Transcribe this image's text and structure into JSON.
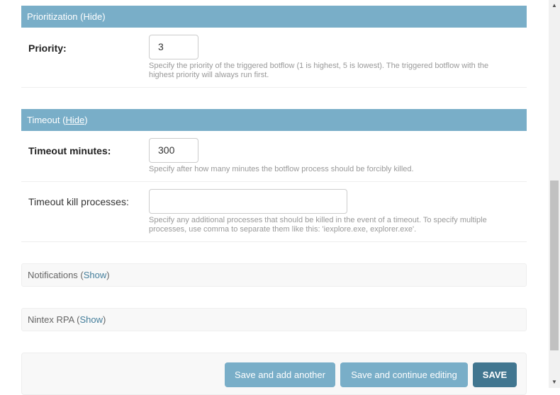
{
  "prioritization": {
    "title": "Prioritization",
    "toggle_prefix": " (",
    "toggle": "Hide",
    "toggle_suffix": ")",
    "priority": {
      "label": "Priority:",
      "value": "3",
      "help": "Specify the priority of the triggered botflow (1 is highest, 5 is lowest). The triggered botflow with the highest priority will always run first."
    }
  },
  "timeout": {
    "title": "Timeout",
    "toggle_prefix": " (",
    "toggle": "Hide",
    "toggle_suffix": ")",
    "minutes": {
      "label": "Timeout minutes:",
      "value": "300",
      "help": "Specify after how many minutes the botflow process should be forcibly killed."
    },
    "kill_processes": {
      "label": "Timeout kill processes:",
      "value": "",
      "help": "Specify any additional processes that should be killed in the event of a timeout. To specify multiple processes, use comma to separate them like this: 'iexplore.exe, explorer.exe'."
    }
  },
  "notifications": {
    "title": "Notifications",
    "toggle_prefix": " (",
    "toggle": "Show",
    "toggle_suffix": ")"
  },
  "nintex_rpa": {
    "title": "Nintex RPA",
    "toggle_prefix": " (",
    "toggle": "Show",
    "toggle_suffix": ")"
  },
  "submit": {
    "save_add_another": "Save and add another",
    "save_continue": "Save and continue editing",
    "save": "SAVE"
  },
  "scrollbar": {
    "up_arrow": "▲",
    "down_arrow": "▼"
  }
}
